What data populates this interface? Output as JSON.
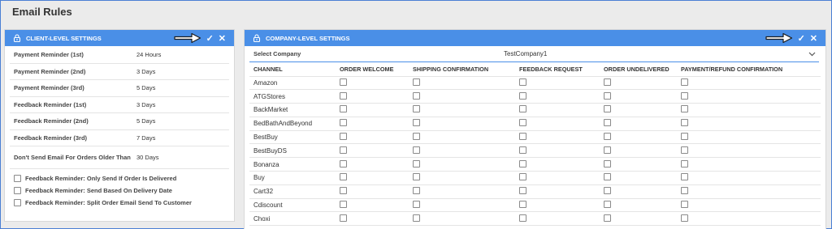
{
  "page": {
    "title": "Email Rules"
  },
  "client": {
    "header": "CLIENT-LEVEL SETTINGS",
    "save_icon": "✓",
    "close_icon": "✕",
    "rows": [
      {
        "label": "Payment Reminder (1st)",
        "value": "24 Hours"
      },
      {
        "label": "Payment Reminder (2nd)",
        "value": "3 Days"
      },
      {
        "label": "Payment Reminder (3rd)",
        "value": "5 Days"
      },
      {
        "label": "Feedback Reminder (1st)",
        "value": "3 Days"
      },
      {
        "label": "Feedback Reminder (2nd)",
        "value": "5 Days"
      },
      {
        "label": "Feedback Reminder (3rd)",
        "value": "7 Days"
      },
      {
        "label": "Don't Send Email For Orders Older Than",
        "value": "30 Days"
      }
    ],
    "checkboxes": [
      {
        "label": "Feedback Reminder: Only Send If Order Is Delivered",
        "checked": false
      },
      {
        "label": "Feedback Reminder: Send Based On Delivery Date",
        "checked": false
      },
      {
        "label": "Feedback Reminder: Split Order Email Send To Customer",
        "checked": false
      }
    ]
  },
  "company": {
    "header": "COMPANY-LEVEL SETTINGS",
    "save_icon": "✓",
    "close_icon": "✕",
    "select_label": "Select Company",
    "select_value": "TestCompany1",
    "columns": [
      "CHANNEL",
      "ORDER WELCOME",
      "SHIPPING CONFIRMATION",
      "FEEDBACK REQUEST",
      "ORDER UNDELIVERED",
      "PAYMENT/REFUND CONFIRMATION"
    ],
    "channels": [
      "Amazon",
      "ATGStores",
      "BackMarket",
      "BedBathAndBeyond",
      "BestBuy",
      "BestBuyDS",
      "Bonanza",
      "Buy",
      "Cart32",
      "Cdiscount",
      "Choxi"
    ]
  },
  "colors": {
    "header_blue": "#4a8fe7",
    "arrow": "#ffffff"
  }
}
